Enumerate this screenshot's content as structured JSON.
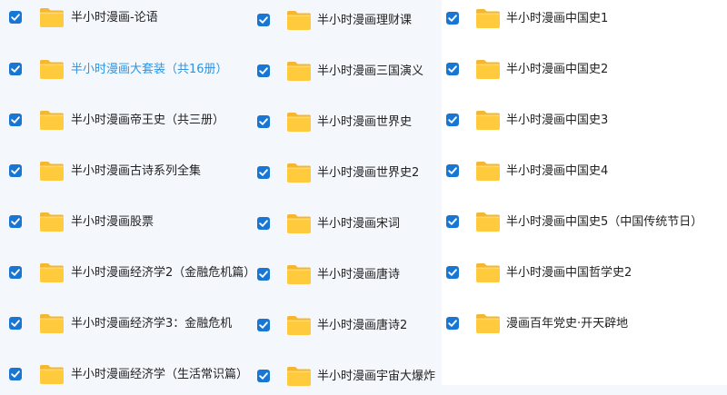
{
  "columns": [
    {
      "items": [
        {
          "name": "半小时漫画-论语",
          "checked": true
        },
        {
          "name": "半小时漫画大套装（共16册）",
          "checked": true,
          "highlighted": true
        },
        {
          "name": "半小时漫画帝王史（共三册）",
          "checked": true
        },
        {
          "name": "半小时漫画古诗系列全集",
          "checked": true
        },
        {
          "name": "半小时漫画股票",
          "checked": true
        },
        {
          "name": "半小时漫画经济学2（金融危机篇）",
          "checked": true
        },
        {
          "name": "半小时漫画经济学3：金融危机",
          "checked": true
        },
        {
          "name": "半小时漫画经济学（生活常识篇）",
          "checked": true
        }
      ]
    },
    {
      "items": [
        {
          "name": "半小时漫画理财课",
          "checked": true
        },
        {
          "name": "半小时漫画三国演义",
          "checked": true
        },
        {
          "name": "半小时漫画世界史",
          "checked": true
        },
        {
          "name": "半小时漫画世界史2",
          "checked": true
        },
        {
          "name": "半小时漫画宋词",
          "checked": true
        },
        {
          "name": "半小时漫画唐诗",
          "checked": true
        },
        {
          "name": "半小时漫画唐诗2",
          "checked": true
        },
        {
          "name": "半小时漫画宇宙大爆炸",
          "checked": true
        }
      ]
    },
    {
      "items": [
        {
          "name": "半小时漫画中国史1",
          "checked": true
        },
        {
          "name": "半小时漫画中国史2",
          "checked": true
        },
        {
          "name": "半小时漫画中国史3",
          "checked": true
        },
        {
          "name": "半小时漫画中国史4",
          "checked": true
        },
        {
          "name": "半小时漫画中国史5（中国传统节日）",
          "checked": true
        },
        {
          "name": "半小时漫画中国哲学史2",
          "checked": true
        },
        {
          "name": "漫画百年党史·开天辟地",
          "checked": true
        }
      ]
    }
  ],
  "colors": {
    "checkbox": "#1976d2",
    "folder_body": "#ffcb3d",
    "folder_back": "#f5b631",
    "highlight_text": "#2f93de"
  },
  "icons": {
    "checkbox": "checkbox-checked-icon",
    "folder": "folder-icon"
  }
}
